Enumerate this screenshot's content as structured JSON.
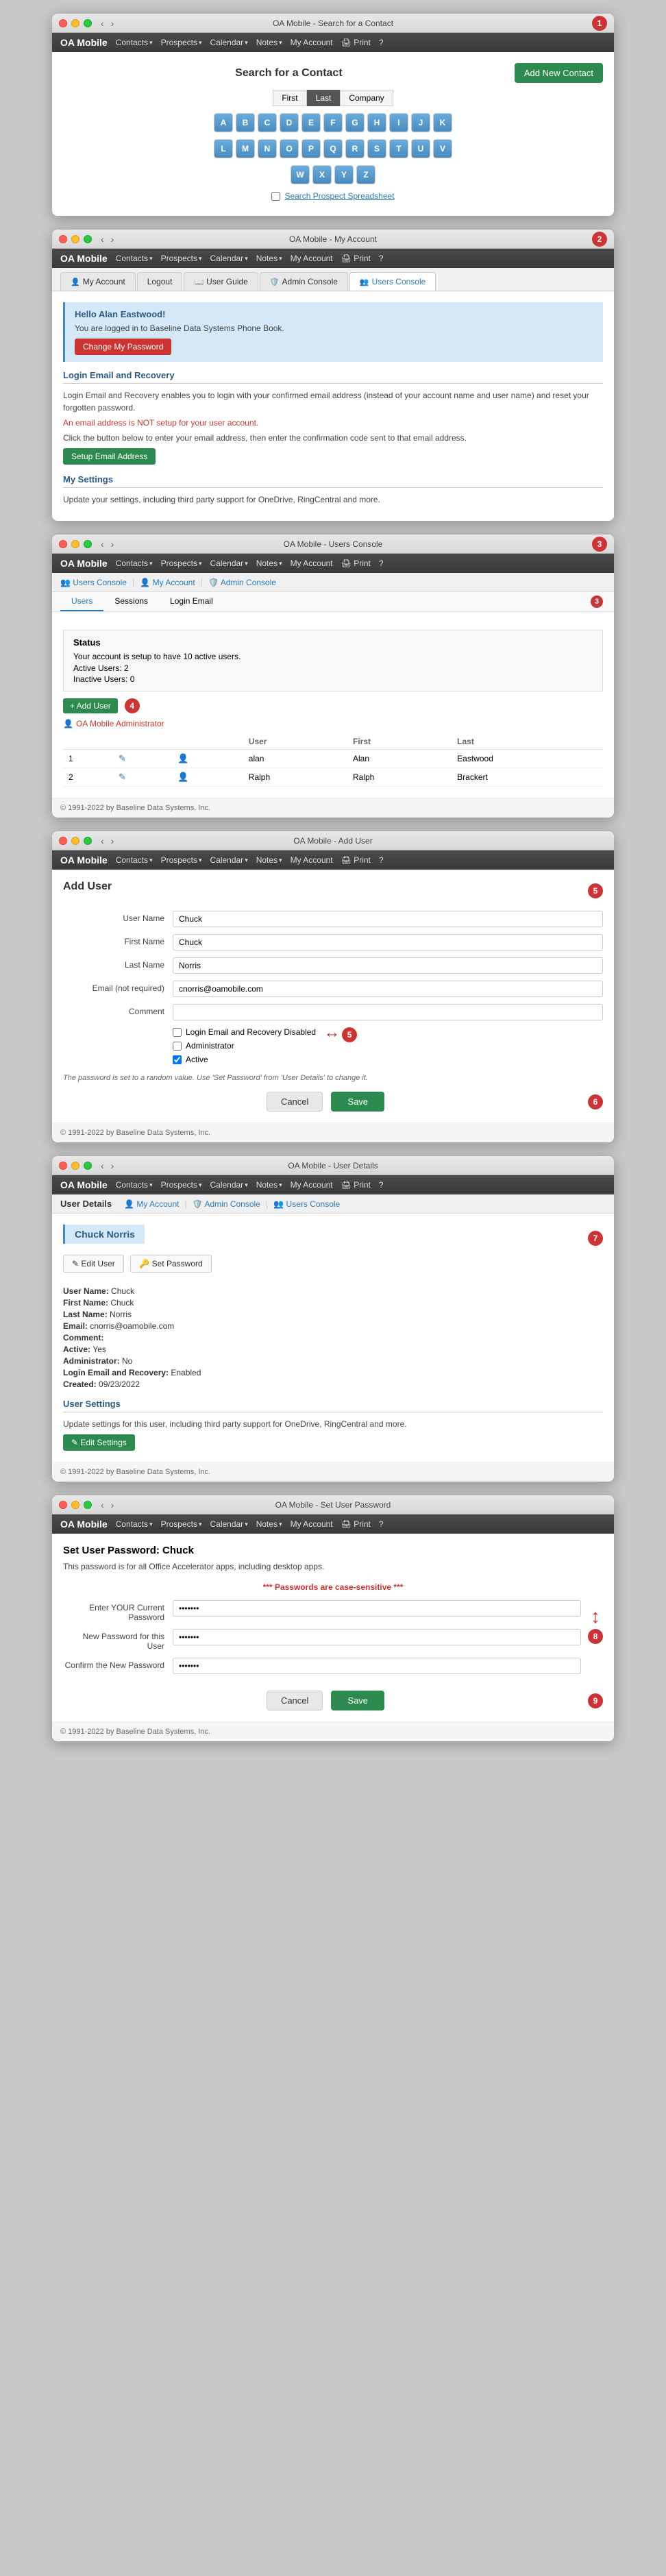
{
  "windows": {
    "w1": {
      "title": "OA Mobile - Search for a Contact",
      "badge": "1",
      "page": {
        "title": "Search for a Contact",
        "add_btn": "Add New Contact",
        "filters": [
          "First",
          "Last",
          "Company"
        ],
        "active_filter": "Last",
        "alpha_row1": [
          "A",
          "B",
          "C",
          "D",
          "E",
          "F",
          "G",
          "H",
          "I",
          "J",
          "K"
        ],
        "alpha_row2": [
          "L",
          "M",
          "N",
          "O",
          "P",
          "Q",
          "R",
          "S",
          "T",
          "U",
          "V"
        ],
        "alpha_row3": [
          "W",
          "X",
          "Y",
          "Z"
        ],
        "search_prospect": "Search Prospect Spreadsheet"
      },
      "nav": {
        "brand": "OA Mobile",
        "items": [
          "Contacts",
          "Prospects",
          "Calendar",
          "Notes",
          "My Account",
          "Print",
          "?"
        ]
      }
    },
    "w2": {
      "title": "OA Mobile - My Account",
      "badge": "2",
      "breadcrumb": "My Account",
      "nav": {
        "brand": "OA Mobile",
        "items": [
          "Contacts",
          "Prospects",
          "Calendar",
          "Notes",
          "My Account",
          "Print",
          "?"
        ]
      },
      "tabs": [
        {
          "label": "My Account",
          "icon": "👤",
          "active": false
        },
        {
          "label": "Logout",
          "icon": "",
          "active": false
        },
        {
          "label": "User Guide",
          "icon": "📖",
          "active": false
        },
        {
          "label": "Admin Console",
          "icon": "🛡️",
          "active": false
        },
        {
          "label": "Users Console",
          "icon": "👥",
          "active": true
        }
      ],
      "greeting": "Hello Alan Eastwood!",
      "logged_in_text": "You are logged in to Baseline Data Systems Phone Book.",
      "change_pwd_btn": "Change My Password",
      "login_email_title": "Login Email and Recovery",
      "login_email_desc": "Login Email and Recovery enables you to login with your confirmed email address (instead of your account name and user name) and reset your forgotten password.",
      "email_error": "An email address is NOT setup for your user account.",
      "email_setup_desc": "Click the button below to enter your email address, then enter the confirmation code sent to that email address.",
      "setup_email_btn": "Setup Email Address",
      "settings_title": "My Settings",
      "settings_desc": "Update your settings, including third party support for OneDrive, RingCentral and more."
    },
    "w3": {
      "title": "OA Mobile - Users Console",
      "badge": "3",
      "breadcrumb": "OA Mobile · Users Console · Users",
      "nav": {
        "brand": "OA Mobile",
        "items": [
          "Contacts",
          "Prospects",
          "Calendar",
          "Notes",
          "My Account",
          "Print",
          "?"
        ]
      },
      "sub_nav": [
        {
          "label": "Users Console",
          "icon": "👥"
        },
        {
          "label": "My Account",
          "icon": "👤"
        },
        {
          "label": "Admin Console",
          "icon": "🛡️"
        }
      ],
      "tabs": [
        "Users",
        "Sessions",
        "Login Email"
      ],
      "active_tab": "Users",
      "status": {
        "title": "Status",
        "line1": "Your account is setup to have 10 active users.",
        "active": "Active Users: 2",
        "inactive": "Inactive Users: 0"
      },
      "badge4": "4",
      "add_user_btn": "+ Add User",
      "admin_label": "OA Mobile Administrator",
      "table_headers": [
        "",
        "",
        "User",
        "First",
        "Last"
      ],
      "users": [
        {
          "num": "1",
          "user": "alan",
          "first": "Alan",
          "last": "Eastwood"
        },
        {
          "num": "2",
          "user": "Ralph",
          "first": "Ralph",
          "last": "Brackert"
        }
      ],
      "footer": "© 1991-2022 by Baseline Data Systems, Inc."
    },
    "w4": {
      "title": "OA Mobile - Add User",
      "badge": "5",
      "breadcrumb": "OA Mobile · Add User",
      "nav": {
        "brand": "OA Mobile",
        "items": [
          "Contacts",
          "Prospects",
          "Calendar",
          "Notes",
          "My Account",
          "Print",
          "?"
        ]
      },
      "page_title": "Add User",
      "fields": {
        "user_name_label": "User Name",
        "user_name_val": "Chuck",
        "first_name_label": "First Name",
        "first_name_val": "Chuck",
        "last_name_label": "Last Name",
        "last_name_val": "Norris",
        "email_label": "Email (not required)",
        "email_val": "cnorris@oamobile.com",
        "comment_label": "Comment",
        "comment_val": ""
      },
      "checkboxes": [
        {
          "label": "Login Email and Recovery Disabled",
          "checked": false
        },
        {
          "label": "Administrator",
          "checked": false
        },
        {
          "label": "Active",
          "checked": true
        }
      ],
      "pwd_note": "The password is set to a random value. Use 'Set Password' from 'User Details' to change it.",
      "cancel_btn": "Cancel",
      "save_btn": "Save",
      "badge6": "6",
      "footer": "© 1991-2022 by Baseline Data Systems, Inc."
    },
    "w5": {
      "title": "OA Mobile - User Details",
      "badge": "7",
      "breadcrumb": "OA Mobile · Users Console · User Details",
      "nav": {
        "brand": "OA Mobile",
        "items": [
          "Contacts",
          "Prospects",
          "Calendar",
          "Notes",
          "My Account",
          "Print",
          "?"
        ]
      },
      "sub_nav": [
        {
          "label": "My Account",
          "icon": "👤"
        },
        {
          "label": "Admin Console",
          "icon": "🛡️"
        },
        {
          "label": "Users Console",
          "icon": "👥"
        }
      ],
      "section_title": "User Details",
      "user_name_display": "Chuck Norris",
      "edit_user_btn": "✎ Edit User",
      "set_pwd_btn": "🔑 Set Password",
      "details": [
        {
          "label": "User Name:",
          "value": "Chuck"
        },
        {
          "label": "First Name:",
          "value": "Chuck"
        },
        {
          "label": "Last Name:",
          "value": "Norris"
        },
        {
          "label": "Email:",
          "value": "cnorris@oamobile.com"
        },
        {
          "label": "Comment:",
          "value": ""
        },
        {
          "label": "Active:",
          "value": "Yes"
        },
        {
          "label": "Administrator:",
          "value": "No"
        },
        {
          "label": "Login Email and Recovery:",
          "value": "Enabled"
        },
        {
          "label": "Created:",
          "value": "09/23/2022"
        }
      ],
      "user_settings_title": "User Settings",
      "user_settings_desc": "Update settings for this user, including third party support for OneDrive, RingCentral and more.",
      "edit_settings_btn": "✎ Edit Settings",
      "footer": "© 1991-2022 by Baseline Data Systems, Inc."
    },
    "w6": {
      "title": "OA Mobile - Set User Password",
      "badge": "8",
      "breadcrumb": "OA Mobile · Set User Password",
      "nav": {
        "brand": "OA Mobile",
        "items": [
          "Contacts",
          "Prospects",
          "Calendar",
          "Notes",
          "My Account",
          "Print",
          "?"
        ]
      },
      "page_title": "Set User Password: Chuck",
      "subtitle": "This password is for all Office Accelerator apps, including desktop apps.",
      "pwd_warning": "*** Passwords are case-sensitive ***",
      "fields": {
        "current_pwd_label": "Enter YOUR Current Password",
        "current_pwd_val": "•••••••",
        "new_pwd_label": "New Password for this User",
        "new_pwd_val": "•••••••",
        "confirm_pwd_label": "Confirm the New Password",
        "confirm_pwd_val": "•••••••"
      },
      "cancel_btn": "Cancel",
      "save_btn": "Save",
      "badge9": "9",
      "footer": "© 1991-2022 by Baseline Data Systems, Inc."
    }
  }
}
